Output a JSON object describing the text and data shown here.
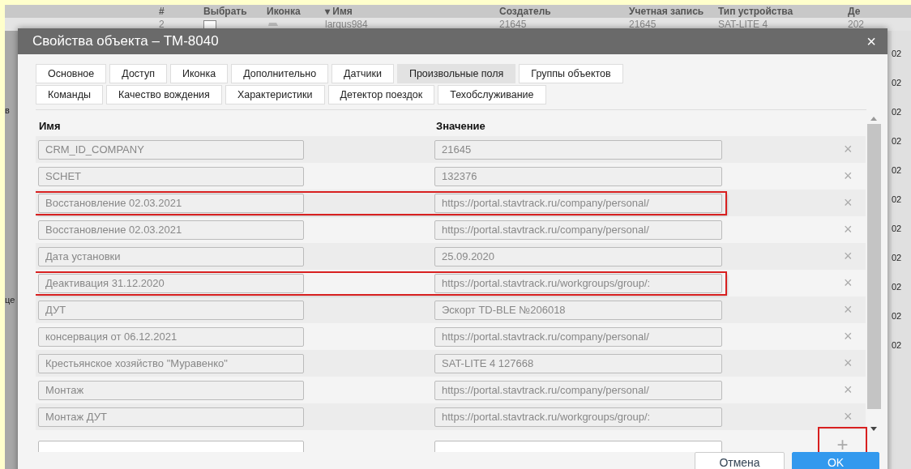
{
  "background_table": {
    "columns": [
      "#",
      "Выбрать",
      "Иконка",
      "▾ Имя",
      "Создатель",
      "Учетная запись",
      "Тип устройства",
      "Де"
    ],
    "row": {
      "number": "2",
      "checked": false,
      "name": "largus984",
      "creator": "21645",
      "account": "21645",
      "device_type": "SAT-LITE 4",
      "column_8": "202"
    },
    "left_edge": [
      "в",
      "це"
    ],
    "right_edge": [
      "02",
      "02",
      "02",
      "02",
      "02",
      "02",
      "02",
      "02",
      "02",
      "02",
      "02"
    ]
  },
  "dialog": {
    "title": "Свойства объекта – TM-8040",
    "close": "×",
    "tab_rows": [
      [
        {
          "label": "Основное",
          "selected": false
        },
        {
          "label": "Доступ",
          "selected": false
        },
        {
          "label": "Иконка",
          "selected": false
        },
        {
          "label": "Дополнительно",
          "selected": false
        },
        {
          "label": "Датчики",
          "selected": false
        },
        {
          "label": "Произвольные поля",
          "selected": true
        },
        {
          "label": "Группы объектов",
          "selected": false
        }
      ],
      [
        {
          "label": "Команды",
          "selected": false
        },
        {
          "label": "Качество вождения",
          "selected": false
        },
        {
          "label": "Характеристики",
          "selected": false
        },
        {
          "label": "Детектор поездок",
          "selected": false
        },
        {
          "label": "Техобслуживание",
          "selected": false
        }
      ]
    ],
    "columns": [
      "Имя",
      "Значение"
    ],
    "fields": [
      {
        "name": "CRM_ID_COMPANY",
        "value": "21645",
        "highlighted": false
      },
      {
        "name": "SCHET",
        "value": "132376",
        "highlighted": false
      },
      {
        "name": "Восстановление 02.03.2021",
        "value": "https://portal.stavtrack.ru/company/personal/",
        "highlighted": true
      },
      {
        "name": "Восстановление 02.03.2021",
        "value": "https://portal.stavtrack.ru/company/personal/",
        "highlighted": false
      },
      {
        "name": "Дата установки",
        "value": "25.09.2020",
        "highlighted": false
      },
      {
        "name": "Деактивация 31.12.2020",
        "value": "https://portal.stavtrack.ru/workgroups/group/:",
        "highlighted": true
      },
      {
        "name": "ДУТ",
        "value": "Эскорт TD-BLE №206018",
        "highlighted": false
      },
      {
        "name": "консервация от 06.12.2021",
        "value": "https://portal.stavtrack.ru/company/personal/",
        "highlighted": false
      },
      {
        "name": "Крестьянское хозяйство \"Муравенко\"",
        "value": "SAT-LITE 4 127668",
        "highlighted": false
      },
      {
        "name": "Монтаж",
        "value": "https://portal.stavtrack.ru/company/personal/",
        "highlighted": false
      },
      {
        "name": "Монтаж ДУТ",
        "value": "https://portal.stavtrack.ru/workgroups/group/:",
        "highlighted": false
      }
    ],
    "remove_symbol": "×",
    "add": {
      "symbol": "+",
      "highlighted": true
    },
    "buttons": [
      {
        "label": "Отмена",
        "kind": "secondary"
      },
      {
        "label": "OK",
        "kind": "primary"
      }
    ]
  }
}
